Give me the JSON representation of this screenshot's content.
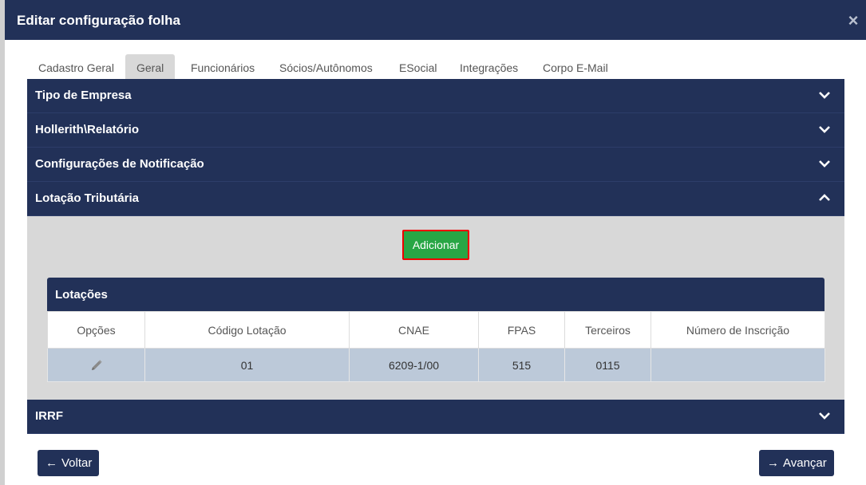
{
  "dialog": {
    "title": "Editar configuração folha",
    "close_symbol": "×"
  },
  "tabs": [
    {
      "label": "Cadastro Geral"
    },
    {
      "label": "Geral"
    },
    {
      "label": "Funcionários"
    },
    {
      "label": "Sócios/Autônomos"
    },
    {
      "label": "ESocial"
    },
    {
      "label": "Integrações"
    },
    {
      "label": "Corpo E-Mail"
    }
  ],
  "active_tab": "Geral",
  "sections": [
    {
      "title": "Tipo de Empresa",
      "expanded": false
    },
    {
      "title": "Hollerith\\Relatório",
      "expanded": false
    },
    {
      "title": "Configurações de Notificação",
      "expanded": false
    },
    {
      "title": "Lotação Tributária",
      "expanded": true
    },
    {
      "title": "IRRF",
      "expanded": false
    }
  ],
  "lotacao": {
    "add_button": "Adicionar",
    "panel_title": "Lotações",
    "columns": [
      "Opções",
      "Código Lotação",
      "CNAE",
      "FPAS",
      "Terceiros",
      "Número de Inscrição"
    ],
    "rows": [
      {
        "codigo": "01",
        "cnae": "6209-1/00",
        "fpas": "515",
        "terceiros": "0115",
        "inscricao": ""
      }
    ]
  },
  "footer": {
    "back_label": "Voltar",
    "next_label": "Avançar"
  },
  "colors": {
    "header_bg": "#223158",
    "add_button": "#28a645",
    "row_bg": "#bcc9d9"
  }
}
